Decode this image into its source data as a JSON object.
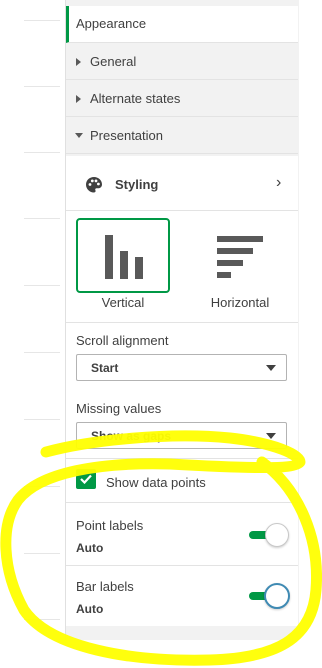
{
  "sections": {
    "appearance": "Appearance",
    "general": "General",
    "alternate_states": "Alternate states",
    "presentation": "Presentation"
  },
  "styling": {
    "label": "Styling",
    "chevron": "›"
  },
  "orientation": {
    "vertical": "Vertical",
    "horizontal": "Horizontal",
    "selected": "Vertical"
  },
  "scroll_alignment": {
    "label": "Scroll alignment",
    "value": "Start"
  },
  "missing_values": {
    "label": "Missing values",
    "value": "Show as gaps"
  },
  "show_data_points": {
    "label": "Show data points",
    "checked": true
  },
  "point_labels": {
    "label": "Point labels",
    "value": "Auto",
    "on": true
  },
  "bar_labels": {
    "label": "Bar labels",
    "value": "Auto",
    "on": true
  },
  "colors": {
    "accent": "#009845",
    "panel_bg": "#f2f2f2",
    "highlight": "#ffff00"
  },
  "icons": [
    "palette-icon",
    "chevron-right-icon",
    "vertical-bars-icon",
    "horizontal-bars-icon",
    "check-icon",
    "caret-down-icon"
  ]
}
